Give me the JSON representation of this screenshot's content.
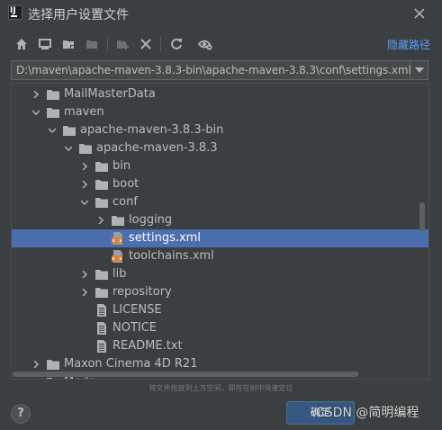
{
  "window": {
    "title": "选择用户设置文件",
    "app_icon": "intellij-idea-icon",
    "close_icon": "close-icon"
  },
  "toolbar": {
    "buttons": [
      {
        "icon": "home-icon"
      },
      {
        "icon": "desktop-icon"
      },
      {
        "icon": "project-folder-icon"
      },
      {
        "icon": "module-folder-icon"
      },
      {
        "icon": "new-folder-icon"
      },
      {
        "icon": "delete-icon"
      },
      {
        "icon": "refresh-icon"
      },
      {
        "icon": "show-hidden-icon"
      }
    ],
    "hide_path_label": "隐藏路径"
  },
  "path": {
    "value": "D:\\maven\\apache-maven-3.8.3-bin\\apache-maven-3.8.3\\conf\\settings.xml",
    "dropdown_icon": "chevron-down-icon"
  },
  "tree": {
    "items": [
      {
        "label": "MailMasterData",
        "type": "folder",
        "depth": 1,
        "expanded": false
      },
      {
        "label": "maven",
        "type": "folder",
        "depth": 1,
        "expanded": true
      },
      {
        "label": "apache-maven-3.8.3-bin",
        "type": "folder",
        "depth": 2,
        "expanded": true
      },
      {
        "label": "apache-maven-3.8.3",
        "type": "folder",
        "depth": 3,
        "expanded": true
      },
      {
        "label": "bin",
        "type": "folder",
        "depth": 4,
        "expanded": false
      },
      {
        "label": "boot",
        "type": "folder",
        "depth": 4,
        "expanded": false
      },
      {
        "label": "conf",
        "type": "folder",
        "depth": 4,
        "expanded": true
      },
      {
        "label": "logging",
        "type": "folder",
        "depth": 5,
        "expanded": false
      },
      {
        "label": "settings.xml",
        "type": "xml",
        "depth": 5,
        "selected": true
      },
      {
        "label": "toolchains.xml",
        "type": "xml",
        "depth": 5
      },
      {
        "label": "lib",
        "type": "folder",
        "depth": 4,
        "expanded": false
      },
      {
        "label": "repository",
        "type": "folder",
        "depth": 4,
        "expanded": false
      },
      {
        "label": "LICENSE",
        "type": "file",
        "depth": 4
      },
      {
        "label": "NOTICE",
        "type": "file",
        "depth": 4
      },
      {
        "label": "README.txt",
        "type": "file",
        "depth": 4
      },
      {
        "label": "Maxon Cinema 4D R21",
        "type": "folder",
        "depth": 1,
        "expanded": false
      },
      {
        "label": "Modo",
        "type": "folder",
        "depth": 1,
        "expanded": false
      }
    ]
  },
  "hint": "将文件拖放到上方空间，即可在树中快速定位",
  "footer": {
    "help_label": "?",
    "ok_label": "确定",
    "watermark": "CSDN @简明编程"
  },
  "colors": {
    "background": "#3c3f41",
    "selection": "#4b6eaf",
    "link": "#589df6",
    "folder": "#afb1b3",
    "xml": "#d8803f"
  }
}
